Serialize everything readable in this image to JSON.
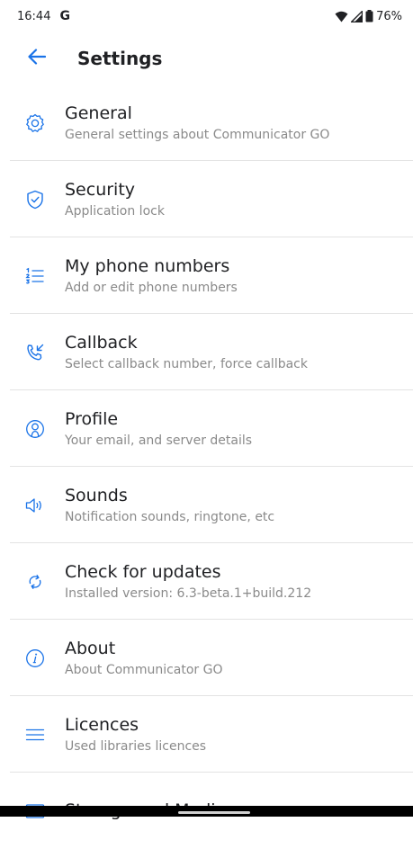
{
  "status_bar": {
    "time": "16:44",
    "app_icon": "G",
    "battery": "76%"
  },
  "app_bar": {
    "title": "Settings",
    "back_icon": "arrow-left-icon"
  },
  "accent_color": "#1a73e8",
  "settings": [
    {
      "label": "General",
      "sub": "General settings about Communicator GO",
      "icon": "gear-icon"
    },
    {
      "label": "Security",
      "sub": "Application lock",
      "icon": "shield-check-icon"
    },
    {
      "label": "My phone numbers",
      "sub": "Add or edit phone numbers",
      "icon": "numbered-list-icon"
    },
    {
      "label": "Callback",
      "sub": "Select callback number, force callback",
      "icon": "phone-callback-icon"
    },
    {
      "label": "Profile",
      "sub": "Your email, and server details",
      "icon": "profile-icon"
    },
    {
      "label": "Sounds",
      "sub": "Notification sounds, ringtone, etc",
      "icon": "speaker-icon"
    },
    {
      "label": "Check for updates",
      "sub": "Installed version: 6.3-beta.1+build.212",
      "icon": "sync-icon"
    },
    {
      "label": "About",
      "sub": "About Communicator GO",
      "icon": "info-icon"
    },
    {
      "label": "Licences",
      "sub": "Used libraries licences",
      "icon": "menu-lines-icon"
    },
    {
      "label": "Storage and Media",
      "sub": "",
      "icon": "storage-icon"
    }
  ]
}
